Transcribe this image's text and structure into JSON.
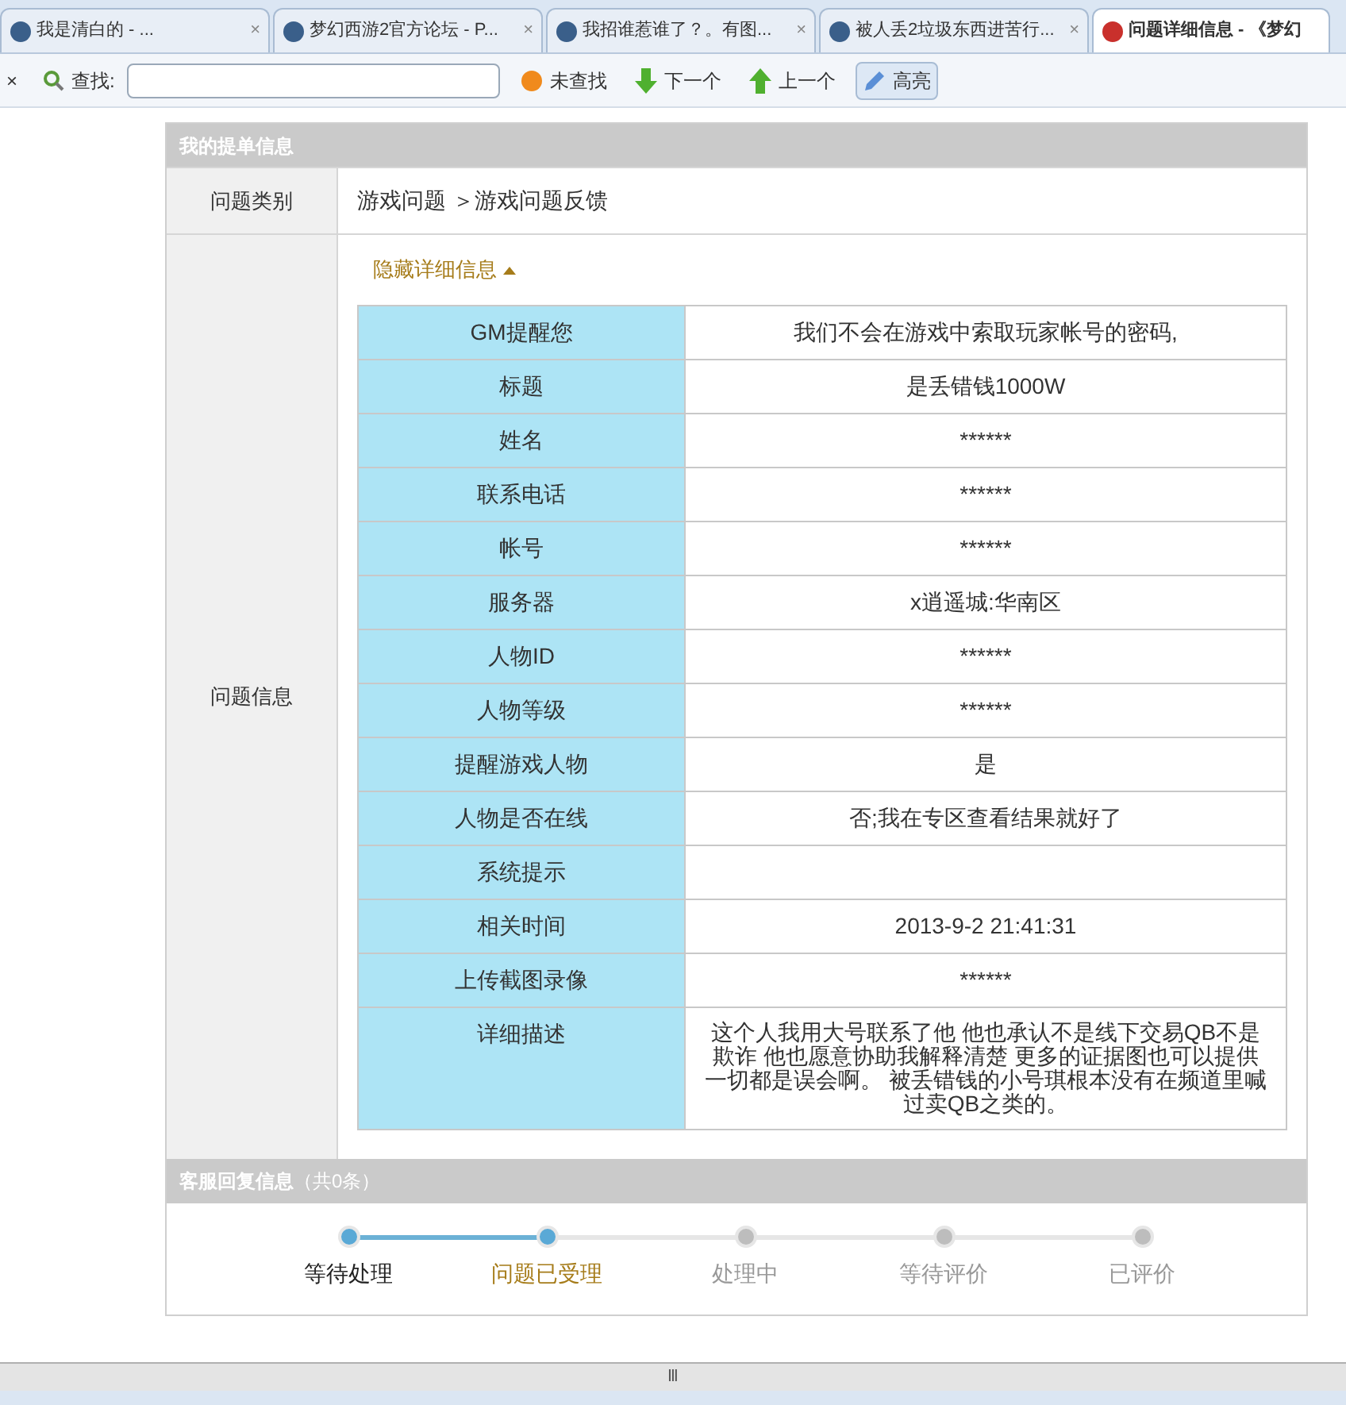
{
  "browser_tabs": [
    {
      "title": "我是清白的 - ...",
      "close": "×",
      "selected": false
    },
    {
      "title": "梦幻西游2官方论坛 - P...",
      "close": "×",
      "selected": false
    },
    {
      "title": "我招谁惹谁了？。有图...",
      "close": "×",
      "selected": false
    },
    {
      "title": "被人丢2垃圾东西进苦行...",
      "close": "×",
      "selected": false
    },
    {
      "title": "问题详细信息 - 《梦幻",
      "selected": true
    }
  ],
  "find_bar": {
    "close": "×",
    "label": "查找:",
    "buttons": [
      {
        "label": "未查找",
        "kind": "status",
        "pressed": false
      },
      {
        "label": "下一个",
        "kind": "next",
        "pressed": false
      },
      {
        "label": "上一个",
        "kind": "prev",
        "pressed": false
      },
      {
        "label": "高亮",
        "kind": "highlight",
        "pressed": true
      }
    ]
  },
  "ticket": {
    "header": "我的提单信息",
    "category_label": "问题类别",
    "category_value": "游戏问题 ＞游戏问题反馈",
    "info_label": "问题信息",
    "toggle": "隐藏详细信息",
    "expanded": true,
    "details": [
      {
        "label": "GM提醒您",
        "value": "我们不会在游戏中索取玩家帐号的密码,"
      },
      {
        "label": "标题",
        "value": "是丢错钱1000W"
      },
      {
        "label": "姓名",
        "value": "******"
      },
      {
        "label": "联系电话",
        "value": "******"
      },
      {
        "label": "帐号",
        "value": "******"
      },
      {
        "label": "服务器",
        "value": "x逍遥城:华南区"
      },
      {
        "label": "人物ID",
        "value": "******"
      },
      {
        "label": "人物等级",
        "value": "******"
      },
      {
        "label": "提醒游戏人物",
        "value": "是"
      },
      {
        "label": "人物是否在线",
        "value": "否;我在专区查看结果就好了"
      },
      {
        "label": "系统提示"
      },
      {
        "label": "相关时间",
        "value": "2013-9-2 21:41:31"
      },
      {
        "label": "上传截图录像",
        "value": "******"
      },
      {
        "label": "详细描述",
        "value": "这个人我用大号联系了他 他也承认不是线下交易QB不是欺诈 他也愿意协助我解释清楚 更多的证据图也可以提供一切都是误会啊。 被丢错钱的小号琪根本没有在频道里喊过卖QB之类的。"
      }
    ]
  },
  "reply": {
    "header": "客服回复信息",
    "count": "（共0条）",
    "steps": [
      {
        "label": "等待处理",
        "reached": true,
        "selected": false
      },
      {
        "label": "问题已受理",
        "reached": true,
        "selected": true
      },
      {
        "label": "处理中",
        "reached": false,
        "selected": false
      },
      {
        "label": "等待评价",
        "reached": false,
        "selected": false
      },
      {
        "label": "已评价",
        "reached": false,
        "selected": false
      }
    ]
  },
  "scrollbar_grip": "Ⅲ"
}
